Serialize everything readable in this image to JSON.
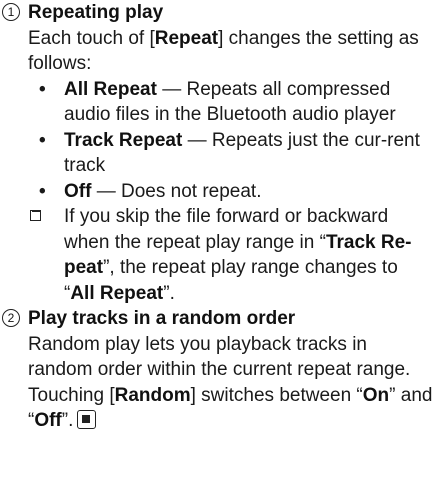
{
  "section1": {
    "number": "1",
    "heading": "Repeating play",
    "intro": {
      "pre": "Each touch of [",
      "key": "Repeat",
      "post": "] changes the setting as follows:"
    },
    "bullets": [
      {
        "term": "All Repeat",
        "dash": " — ",
        "desc": "Repeats all compressed audio files in the Bluetooth audio player"
      },
      {
        "term": "Track Repeat",
        "dash": " — ",
        "desc": "Repeats just the cur-rent track"
      },
      {
        "term": "Off",
        "dash": " — ",
        "desc": "Does not repeat."
      }
    ],
    "bullet_glyph": "•",
    "note": {
      "pre": "If you skip the file forward or backward when the repeat play range in “",
      "term1": "Track Re-peat",
      "mid": "”, the repeat play range changes to “",
      "term2": "All Repeat",
      "post": "”."
    }
  },
  "section2": {
    "number": "2",
    "heading": "Play tracks in a random order",
    "para1": "Random play lets you playback tracks in random order within the current repeat range.",
    "para2": {
      "pre": "Touching [",
      "key": "Random",
      "mid1": "] switches between “",
      "on": "On",
      "mid2": "” and “",
      "off": "Off",
      "post": "”."
    }
  }
}
